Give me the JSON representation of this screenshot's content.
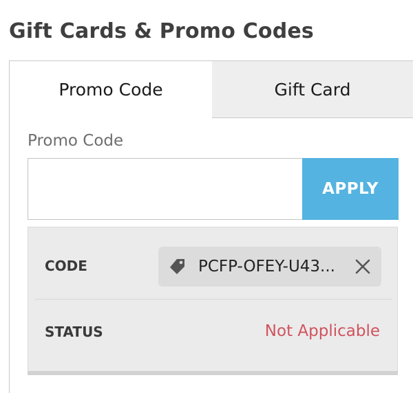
{
  "header": {
    "title": "Gift Cards & Promo Codes"
  },
  "tabs": [
    {
      "label": "Promo Code",
      "active": true
    },
    {
      "label": "Gift Card",
      "active": false
    }
  ],
  "promo_form": {
    "field_label": "Promo Code",
    "input_value": "",
    "input_placeholder": "",
    "apply_label": "APPLY"
  },
  "summary": {
    "code_label": "CODE",
    "code_value": "PCFP-OFEY-U43...",
    "code_icon": "tag-icon",
    "remove_icon": "close-icon",
    "status_label": "STATUS",
    "status_value": "Not Applicable"
  },
  "colors": {
    "accent": "#54b3e0",
    "status_error": "#d0535e",
    "summary_bg": "#ebebeb",
    "inactive_tab_bg": "#eeeeee"
  }
}
